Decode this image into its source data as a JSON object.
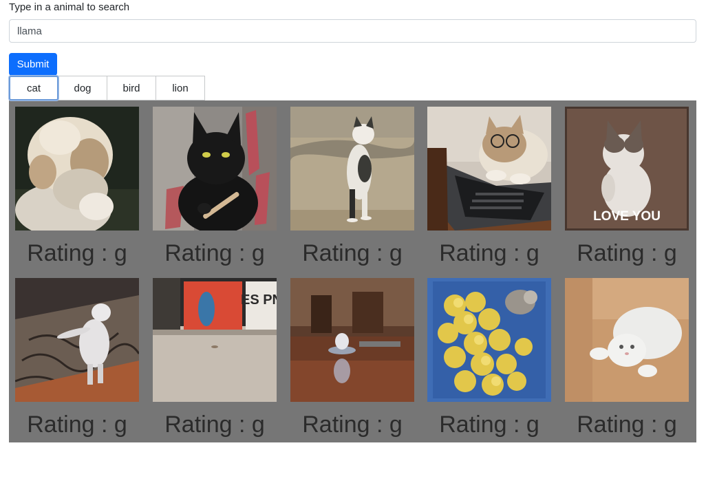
{
  "search": {
    "label": "Type in a animal to search",
    "value": "llama"
  },
  "submit_label": "Submit",
  "tags": [
    {
      "label": "cat",
      "active": true
    },
    {
      "label": "dog",
      "active": false
    },
    {
      "label": "bird",
      "active": false
    },
    {
      "label": "lion",
      "active": false
    }
  ],
  "results": [
    {
      "rating": "Rating : g",
      "image": "fluffy-cat-gif"
    },
    {
      "rating": "Rating : g",
      "image": "black-cat-nail-file-gif"
    },
    {
      "rating": "Rating : g",
      "image": "cat-standing-beach-gif"
    },
    {
      "rating": "Rating : g",
      "image": "cat-glasses-laptop-gif"
    },
    {
      "rating": "Rating : g",
      "image": "cat-love-you-gif",
      "caption": "LOVE YOU"
    },
    {
      "rating": "Rating : g",
      "image": "white-cat-dancing-rug-gif"
    },
    {
      "rating": "Rating : g",
      "image": "espn-floor-gif",
      "caption": "ES PN"
    },
    {
      "rating": "Rating : g",
      "image": "cat-on-robot-vacuum-gif"
    },
    {
      "rating": "Rating : g",
      "image": "chicks-and-cat-basket-gif"
    },
    {
      "rating": "Rating : g",
      "image": "white-cat-lying-gif"
    }
  ]
}
